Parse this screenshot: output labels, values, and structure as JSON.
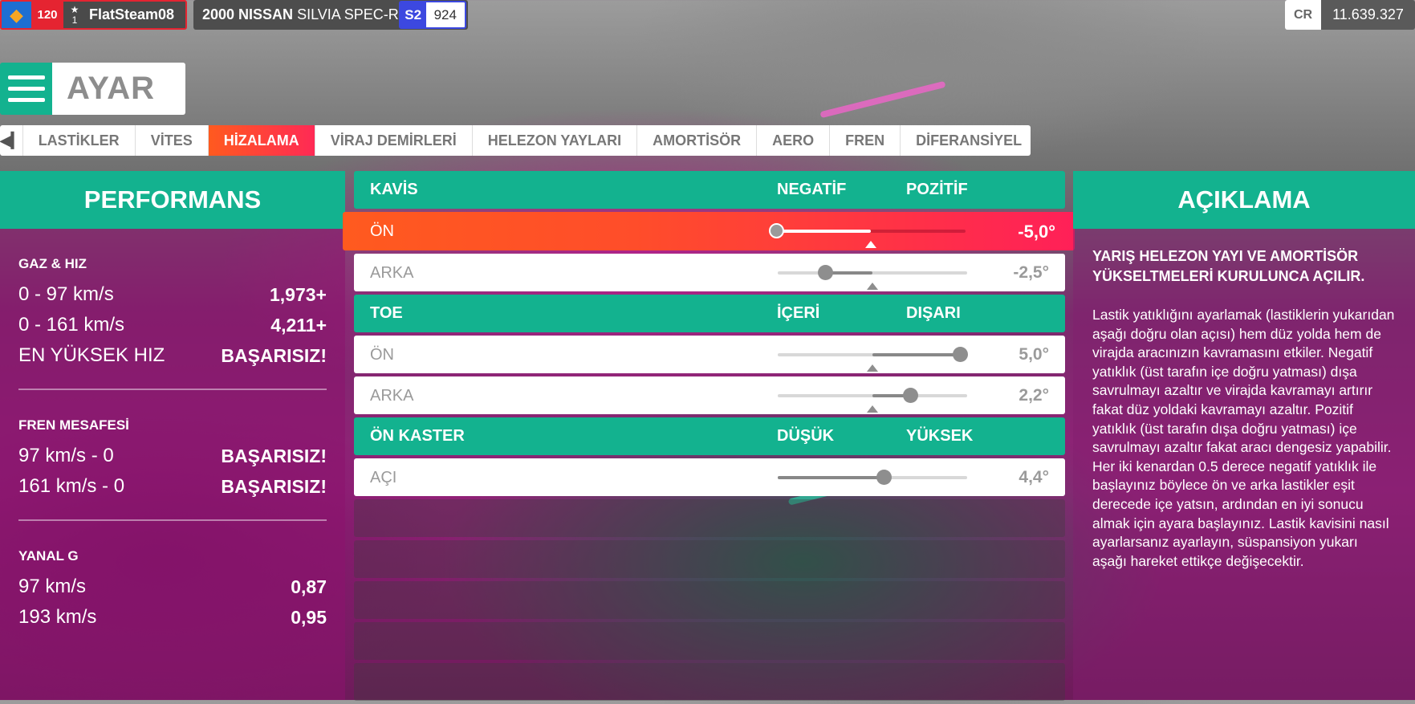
{
  "player": {
    "level": "120",
    "rank": "1",
    "gamertag": "FlatSteam08"
  },
  "car": {
    "name_bold": "2000 NISSAN",
    "name_rest": "SILVIA SPEC-R",
    "pi_class": "S2",
    "pi_value": "924"
  },
  "credits": {
    "label": "CR",
    "value": "11.639.327"
  },
  "page_title": "AYAR",
  "tabs": [
    {
      "label": "LASTİKLER"
    },
    {
      "label": "VİTES"
    },
    {
      "label": "HİZALAMA",
      "active": true
    },
    {
      "label": "VİRAJ DEMİRLERİ"
    },
    {
      "label": "HELEZON YAYLARI"
    },
    {
      "label": "AMORTİSÖR"
    },
    {
      "label": "AERO"
    },
    {
      "label": "FREN"
    },
    {
      "label": "DİFERANSİYEL"
    }
  ],
  "performance": {
    "title": "PERFORMANS",
    "sections": [
      {
        "title": "GAZ & HIZ",
        "rows": [
          {
            "label": "0 - 97 km/s",
            "value": "1,973+"
          },
          {
            "label": "0 - 161 km/s",
            "value": "4,211+"
          },
          {
            "label": "EN YÜKSEK HIZ",
            "value": "BAŞARISIZ!"
          }
        ]
      },
      {
        "title": "FREN MESAFESİ",
        "rows": [
          {
            "label": "97 km/s - 0",
            "value": "BAŞARISIZ!"
          },
          {
            "label": "161 km/s - 0",
            "value": "BAŞARISIZ!"
          }
        ]
      },
      {
        "title": "YANAL G",
        "rows": [
          {
            "label": "97 km/s",
            "value": "0,87"
          },
          {
            "label": "193 km/s",
            "value": "0,95"
          }
        ]
      }
    ]
  },
  "tuning": {
    "camber": {
      "title": "KAVİS",
      "low": "NEGATİF",
      "high": "POZİTİF",
      "front": {
        "label": "ÖN",
        "value": "-5,0°",
        "position": 0.0,
        "default": 0.5
      },
      "rear": {
        "label": "ARKA",
        "value": "-2,5°",
        "position": 0.25,
        "default": 0.5
      }
    },
    "toe": {
      "title": "TOE",
      "low": "İÇERİ",
      "high": "DIŞARI",
      "front": {
        "label": "ÖN",
        "value": "5,0°",
        "position": 0.96,
        "default": 0.5
      },
      "rear": {
        "label": "ARKA",
        "value": "2,2°",
        "position": 0.7,
        "default": 0.5
      }
    },
    "caster": {
      "title": "ÖN KASTER",
      "low": "DÜŞÜK",
      "high": "YÜKSEK",
      "angle": {
        "label": "AÇI",
        "value": "4,4°",
        "position": 0.56
      }
    }
  },
  "description": {
    "title": "AÇIKLAMA",
    "notice": "YARIŞ HELEZON YAYI VE AMORTİSÖR YÜKSELTMELERİ KURULUNCA AÇILIR.",
    "body": "Lastik yatıklığını ayarlamak (lastiklerin yukarıdan aşağı doğru olan açısı) hem düz yolda hem de virajda aracınızın kavramasını etkiler. Negatif yatıklık (üst tarafın içe doğru yatması) dışa savrulmayı azaltır ve virajda kavramayı artırır fakat düz yoldaki kavramayı azaltır. Pozitif yatıklık (üst tarafın dışa doğru yatması) içe savrulmayı azaltır fakat aracı dengesiz yapabilir. Her iki kenardan 0.5 derece negatif yatıklık ile başlayınız böylece ön ve arka lastikler eşit derecede içe yatsın, ardından en iyi sonucu almak için ayara başlayınız. Lastik kavisini nasıl ayarlarsanız ayarlayın, süspansiyon yukarı aşağı hareket ettikçe değişecektir."
  }
}
